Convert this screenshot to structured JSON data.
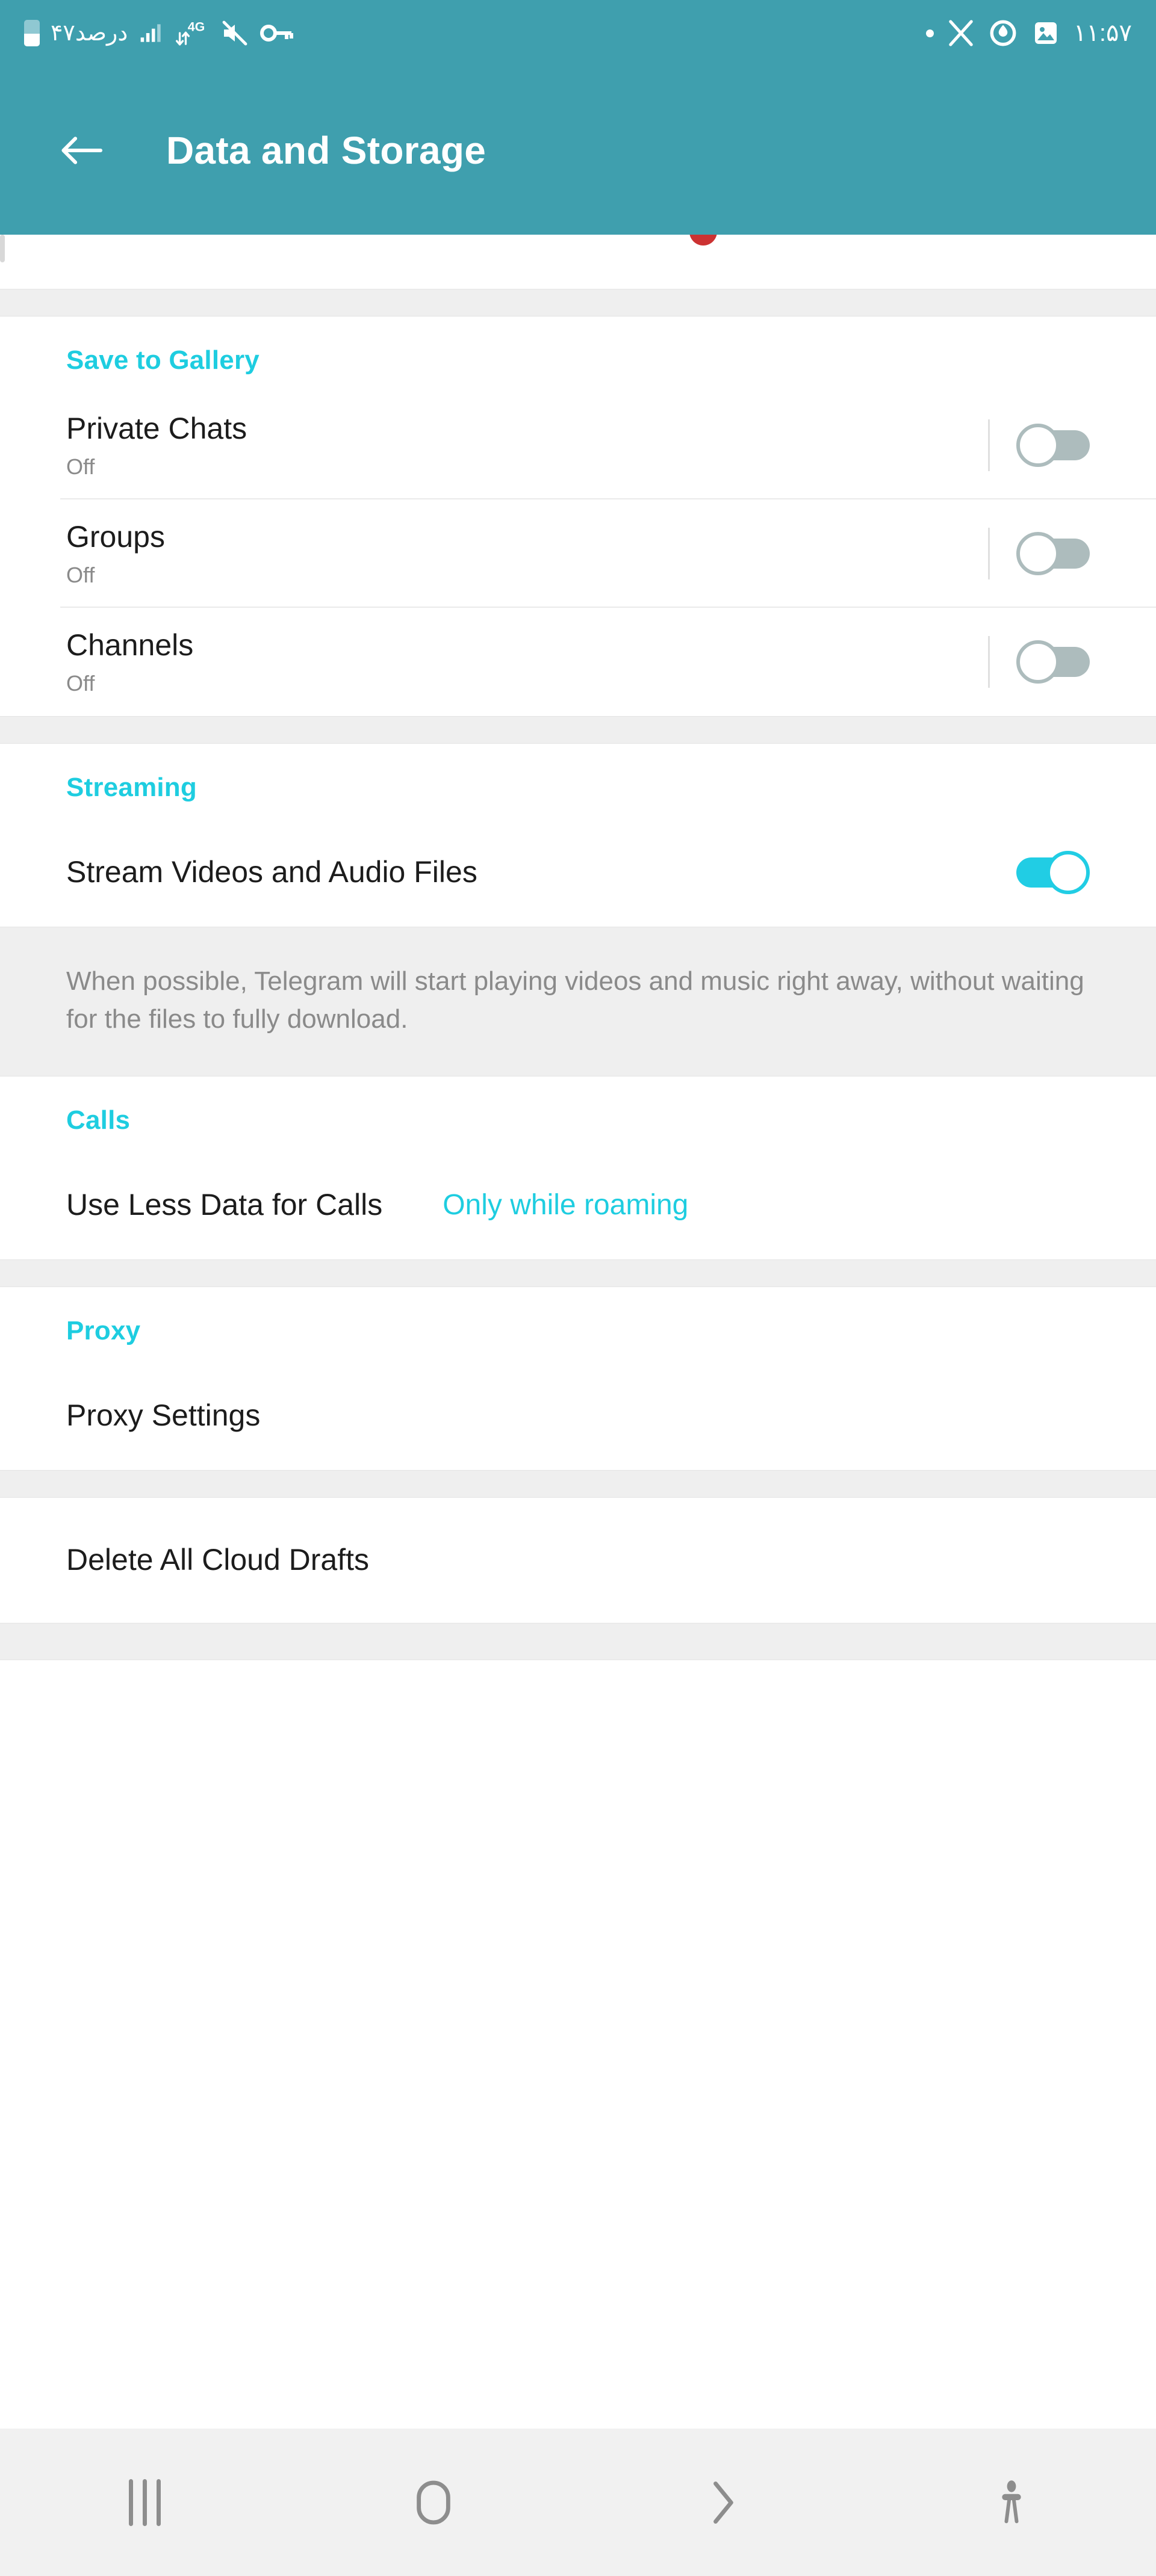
{
  "status_bar": {
    "battery_text": "۴۷درصد",
    "network_type": "4G",
    "time": "۱۱:۵۷",
    "left_icons": [
      "battery-icon",
      "signal-bars-icon",
      "data-transfer-icon",
      "mute-icon",
      "vpn-key-icon"
    ],
    "right_icons": [
      "notification-dot-icon",
      "x-app-icon",
      "power-droplet-icon",
      "gallery-image-icon"
    ],
    "background_color": "#3f9fae"
  },
  "app_bar": {
    "title": "Data and Storage",
    "back_label": "back-arrow",
    "background_color": "#3f9fae"
  },
  "theme": {
    "accent": "#1ecde0",
    "toggle_on": "#21cde4",
    "toggle_off": "#adbcbd",
    "page_bg": "#ffffff",
    "divider_bg": "#efefef"
  },
  "sections": {
    "save_to_gallery": {
      "header": "Save to Gallery",
      "rows": [
        {
          "title": "Private Chats",
          "subtitle": "Off",
          "toggle": "off"
        },
        {
          "title": "Groups",
          "subtitle": "Off",
          "toggle": "off"
        },
        {
          "title": "Channels",
          "subtitle": "Off",
          "toggle": "off"
        }
      ]
    },
    "streaming": {
      "header": "Streaming",
      "row": {
        "title": "Stream Videos and Audio Files",
        "toggle": "on"
      },
      "info": "When possible, Telegram will start playing videos and music right away, without waiting for the files to fully download."
    },
    "calls": {
      "header": "Calls",
      "row": {
        "title": "Use Less Data for Calls",
        "value": "Only while roaming"
      }
    },
    "proxy": {
      "header": "Proxy",
      "row": {
        "title": "Proxy Settings"
      }
    },
    "drafts": {
      "row": {
        "title": "Delete All Cloud Drafts"
      }
    }
  },
  "nav_bar": {
    "items": [
      {
        "icon": "recents-icon",
        "label": "Recents"
      },
      {
        "icon": "home-icon",
        "label": "Home"
      },
      {
        "icon": "back-chevron-icon",
        "label": "Back"
      },
      {
        "icon": "accessibility-icon",
        "label": "Accessibility"
      }
    ]
  }
}
